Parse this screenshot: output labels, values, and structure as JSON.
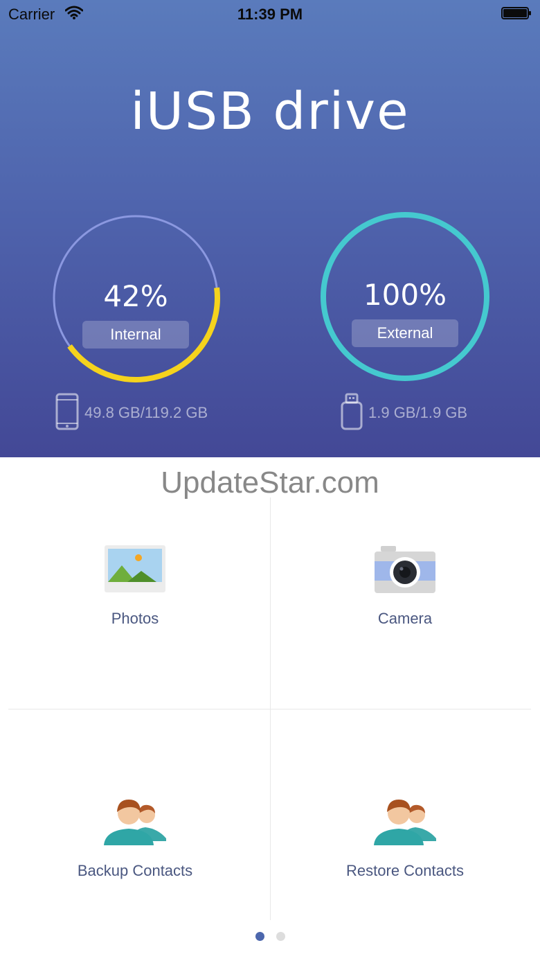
{
  "status_bar": {
    "carrier": "Carrier",
    "time": "11:39 PM"
  },
  "app": {
    "title": "iUSB drive"
  },
  "storage": {
    "internal": {
      "percent_text": "42%",
      "label": "Internal",
      "usage_text": "49.8 GB/119.2 GB",
      "fill_fraction": 0.42,
      "ring_color": "#8b98e0",
      "fill_color": "#f5d31d",
      "icon": "phone-icon"
    },
    "external": {
      "percent_text": "100%",
      "label": "External",
      "usage_text": "1.9 GB/1.9 GB",
      "fill_fraction": 1.0,
      "ring_color": "#45c9cf",
      "fill_color": "#45c9cf",
      "icon": "usb-drive-icon"
    }
  },
  "watermark": "UpdateStar.com",
  "tiles": {
    "photos": {
      "label": "Photos",
      "icon": "photos-icon"
    },
    "camera": {
      "label": "Camera",
      "icon": "camera-icon"
    },
    "backup_contacts": {
      "label": "Backup Contacts",
      "icon": "contacts-icon"
    },
    "restore_contacts": {
      "label": "Restore Contacts",
      "icon": "contacts-icon"
    }
  },
  "pager": {
    "page_count": 2,
    "current_page": 1,
    "active_color": "#4c67ad",
    "inactive_color": "#dddddd"
  }
}
